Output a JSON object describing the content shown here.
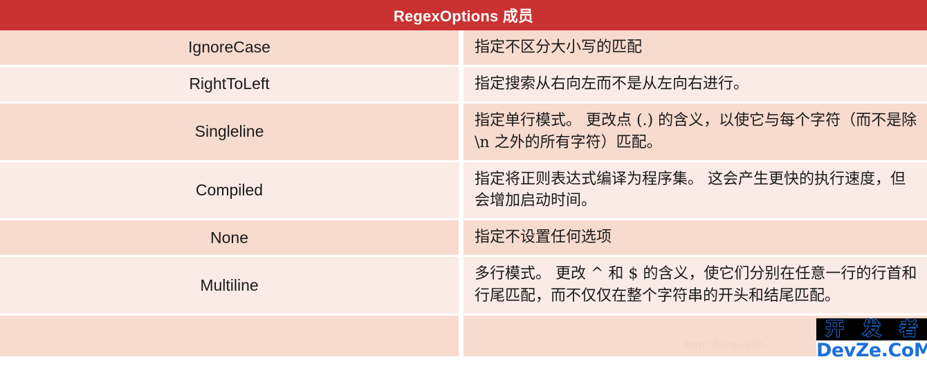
{
  "header": {
    "title": "RegexOptions 成员"
  },
  "columns": {
    "name": "",
    "description": ""
  },
  "rows": [
    {
      "name": "IgnoreCase",
      "description": "指定不区分大小写的匹配"
    },
    {
      "name": "RightToLeft",
      "description": "指定搜索从右向左而不是从左向右进行。"
    },
    {
      "name": "Singleline",
      "description": "指定单行模式。 更改点 (.) 的含义，以使它与每个字符（而不是除 \\n 之外的所有字符）匹配。"
    },
    {
      "name": "Compiled",
      "description": "指定将正则表达式编译为程序集。 这会产生更快的执行速度，但会增加启动时间。"
    },
    {
      "name": "None",
      "description": "指定不设置任何选项"
    },
    {
      "name": "Multiline",
      "description": "多行模式。 更改 ^ 和 $ 的含义，使它们分别在任意一行的行首和行尾匹配，而不仅仅在整个字符串的开头和结尾匹配。"
    },
    {
      "name": "",
      "description": ""
    }
  ],
  "watermarks": {
    "url": "http://blog.csdn.",
    "logo_top_chars": [
      "开",
      "发",
      "者"
    ],
    "logo_bottom": "DevZe.CoM"
  },
  "colors": {
    "header_red": "#C93230",
    "row_dark": "#F7DBCF",
    "row_light": "#FBEBE6",
    "grid_white": "#FFFFFF",
    "logo_blue": "#1E6FD9",
    "watermark_text": "#EBD3C8"
  }
}
